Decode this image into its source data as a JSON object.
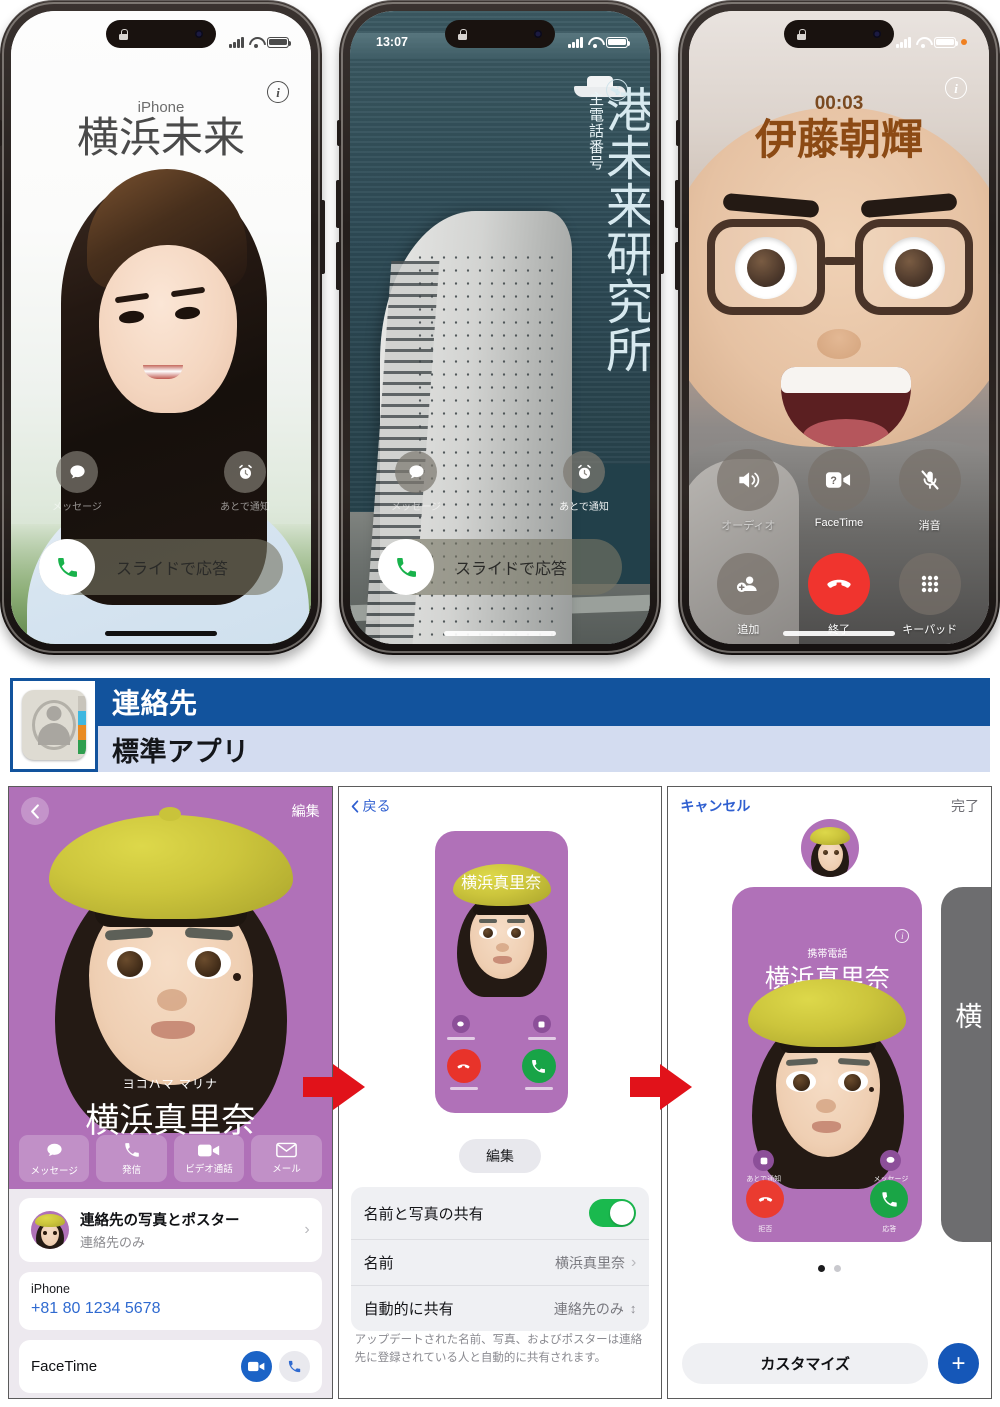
{
  "phones": [
    {
      "id": "incoming-call-photo-poster",
      "statusbar": {
        "time": "",
        "icons": [
          "signal-bars",
          "wifi",
          "battery"
        ]
      },
      "info_button": "i",
      "caller_label": "iPhone",
      "caller_name": "横浜未来",
      "actions": [
        {
          "icon": "message-icon",
          "label": "メッセージ"
        },
        {
          "icon": "alarm-icon",
          "label": "あとで通知"
        }
      ],
      "slide_to_answer": "スライドで応答",
      "answer_icon": "phone-handset-icon"
    },
    {
      "id": "incoming-call-landmark-poster",
      "statusbar": {
        "time": "13:07",
        "icons": [
          "signal-bars",
          "wifi",
          "battery"
        ]
      },
      "info_button": "i",
      "caller_label": "主電話番号",
      "caller_name": "港未来研究所",
      "actions": [
        {
          "icon": "message-icon",
          "label": "メッセージ"
        },
        {
          "icon": "alarm-icon",
          "label": "あとで通知"
        }
      ],
      "slide_to_answer": "スライドで応答",
      "answer_icon": "phone-handset-icon"
    },
    {
      "id": "active-call-memoji",
      "statusbar": {
        "time": "",
        "icons": [
          "signal-bars",
          "wifi",
          "battery",
          "recording-dot"
        ]
      },
      "info_button": "i",
      "call_duration": "00:03",
      "caller_name": "伊藤朝輝",
      "controls": [
        {
          "icon": "speaker-icon",
          "label": "オーディオ"
        },
        {
          "icon": "facetime-video-icon",
          "label": "FaceTime"
        },
        {
          "icon": "mic-muted-icon",
          "label": "消音"
        },
        {
          "icon": "add-call-icon",
          "label": "追加"
        },
        {
          "icon": "end-call-icon",
          "label": "終了"
        },
        {
          "icon": "keypad-icon",
          "label": "キーパッド"
        }
      ]
    }
  ],
  "banner": {
    "title": "連絡先",
    "subtitle": "標準アプリ",
    "icon": "contacts-app-icon",
    "title_bg": "#12539d",
    "subtitle_bg": "#d3dcf0"
  },
  "panels": {
    "contact_card": {
      "back_icon": "chevron-left-icon",
      "edit_label": "編集",
      "kana_name": "ヨコハマ マリナ",
      "display_name": "横浜真里奈",
      "quick_actions": [
        {
          "icon": "message-bubble-icon",
          "label": "メッセージ"
        },
        {
          "icon": "phone-icon",
          "label": "発信"
        },
        {
          "icon": "video-icon",
          "label": "ビデオ通話"
        },
        {
          "icon": "mail-icon",
          "label": "メール"
        }
      ],
      "poster_row": {
        "title": "連絡先の写真とポスター",
        "subtitle": "連絡先のみ",
        "chevron": "chevron-right-icon"
      },
      "phone_row": {
        "label": "iPhone",
        "value": "+81 80 1234 5678"
      },
      "facetime_row": {
        "label": "FaceTime",
        "buttons": [
          {
            "icon": "video-icon"
          },
          {
            "icon": "phone-icon"
          }
        ]
      }
    },
    "poster_preview": {
      "back_label": "戻る",
      "back_icon": "chevron-left-icon",
      "poster_name": "横浜真里奈",
      "poster_buttons": [
        {
          "icon": "message-bubble-icon"
        },
        {
          "icon": "alarm-icon"
        },
        {
          "icon": "decline-call-icon"
        },
        {
          "icon": "accept-call-icon"
        }
      ],
      "edit_label": "編集",
      "settings": [
        {
          "label": "名前と写真の共有",
          "control": "toggle",
          "value": "on"
        },
        {
          "label": "名前",
          "control": "chevron",
          "value": "横浜真里奈"
        },
        {
          "label": "自動的に共有",
          "control": "stepper",
          "value": "連絡先のみ"
        }
      ],
      "note": "アップデートされた名前、写真、およびポスターは連絡先に登録されている人と自動的に共有されます。"
    },
    "poster_editor": {
      "cancel_label": "キャンセル",
      "done_label": "完了",
      "avatar_icon": "memoji-avatar",
      "poster": {
        "info_icon": "i",
        "sub_label": "携帯電話",
        "name": "横浜真里奈",
        "mini_actions": [
          {
            "icon": "alarm-icon",
            "label": "あとで通知"
          },
          {
            "icon": "message-bubble-icon",
            "label": "メッセージ"
          }
        ],
        "answer_actions": [
          {
            "icon": "decline-call-icon",
            "label": "拒否"
          },
          {
            "icon": "accept-call-icon",
            "label": "応答"
          }
        ]
      },
      "side_poster_text": "横",
      "page_dots": {
        "count": 2,
        "active": 0
      },
      "customize_label": "カスタマイズ",
      "add_label": "+"
    }
  },
  "colors": {
    "brand_blue": "#12539d",
    "poster_purple": "#b071b8",
    "accent_green": "#1aa546",
    "accent_red": "#ea3b30",
    "link_blue": "#2f5fd0",
    "arrow_red": "#e1121a"
  }
}
